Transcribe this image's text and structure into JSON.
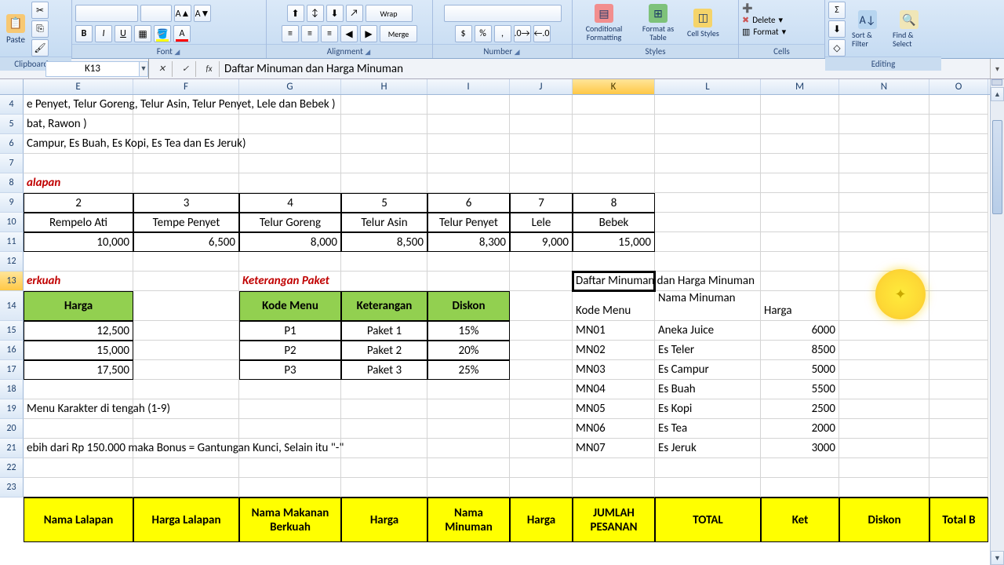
{
  "namebox": "K13",
  "formula": "Daftar Minuman dan Harga Minuman",
  "ribbon": {
    "clipboard": {
      "paste": "Paste",
      "label": "Clipboard"
    },
    "font": {
      "label": "Font",
      "b": "B",
      "i": "I",
      "u": "U"
    },
    "alignment": {
      "label": "Alignment"
    },
    "number": {
      "label": "Number",
      "dollar": "$",
      "pct": "%",
      "comma": ","
    },
    "styles": {
      "conditional": "Conditional Formatting",
      "table": "Format as Table",
      "cell": "Cell Styles",
      "label": "Styles"
    },
    "cells": {
      "delete": "Delete",
      "format": "Format",
      "label": "Cells"
    },
    "editing": {
      "sort": "Sort & Filter",
      "find": "Find & Select",
      "label": "Editing"
    }
  },
  "cols": [
    "E",
    "F",
    "G",
    "H",
    "I",
    "J",
    "K",
    "L",
    "M",
    "N",
    "O"
  ],
  "rows": [
    "4",
    "5",
    "6",
    "7",
    "8",
    "9",
    "10",
    "11",
    "12",
    "13",
    "14",
    "15",
    "16",
    "17",
    "18",
    "19",
    "20",
    "21",
    "22",
    "23"
  ],
  "r4": {
    "E": "e Penyet, Telur Goreng, Telur Asin, Telur Penyet, Lele dan Bebek )"
  },
  "r5": {
    "E": "bat, Rawon )"
  },
  "r6": {
    "E": "Campur, Es Buah, Es Kopi, Es Tea dan Es Jeruk)"
  },
  "r8": {
    "E": "alapan"
  },
  "r9": {
    "E": "2",
    "F": "3",
    "G": "4",
    "H": "5",
    "I": "6",
    "J": "7",
    "K": "8"
  },
  "r10": {
    "E": "Rempelo Ati",
    "F": "Tempe Penyet",
    "G": "Telur Goreng",
    "H": "Telur Asin",
    "I": "Telur Penyet",
    "J": "Lele",
    "K": "Bebek"
  },
  "r11": {
    "E": "10,000",
    "F": "6,500",
    "G": "8,000",
    "H": "8,500",
    "I": "8,300",
    "J": "9,000",
    "K": "15,000"
  },
  "r13": {
    "E": "erkuah",
    "G": "Keterangan Paket",
    "K": "Daftar Minuman dan Harga Minuman"
  },
  "r14": {
    "E": "Harga",
    "G": "Kode Menu",
    "H": "Keterangan",
    "I": "Diskon",
    "K": "Kode Menu",
    "L": "Nama Minuman",
    "M": "Harga"
  },
  "r15": {
    "E": "12,500",
    "G": "P1",
    "H": "Paket 1",
    "I": "15%",
    "K": "MN01",
    "L": "Aneka Juice",
    "M": "6000"
  },
  "r16": {
    "E": "15,000",
    "G": "P2",
    "H": "Paket 2",
    "I": "20%",
    "K": "MN02",
    "L": "Es Teler",
    "M": "8500"
  },
  "r17": {
    "E": "17,500",
    "G": "P3",
    "H": "Paket 3",
    "I": "25%",
    "K": "MN03",
    "L": "Es Campur",
    "M": "5000"
  },
  "r18": {
    "K": "MN04",
    "L": "Es Buah",
    "M": "5500"
  },
  "r19": {
    "E": "Menu Karakter di tengah (1-9)",
    "K": "MN05",
    "L": "Es Kopi",
    "M": "2500"
  },
  "r20": {
    "K": "MN06",
    "L": "Es Tea",
    "M": "2000"
  },
  "r21": {
    "E": "ebih dari Rp 150.000 maka Bonus = Gantungan Kunci, Selain itu \"-\"",
    "K": "MN07",
    "L": "Es Jeruk",
    "M": "3000"
  },
  "bottom_headers": {
    "E": "Nama Lalapan",
    "F": "Harga Lalapan",
    "G": "Nama Makanan Berkuah",
    "H": "Harga",
    "I": "Nama Minuman",
    "J": "Harga",
    "K": "JUMLAH PESANAN",
    "L": "TOTAL",
    "M": "Ket",
    "N": "Diskon",
    "O": "Total B"
  }
}
